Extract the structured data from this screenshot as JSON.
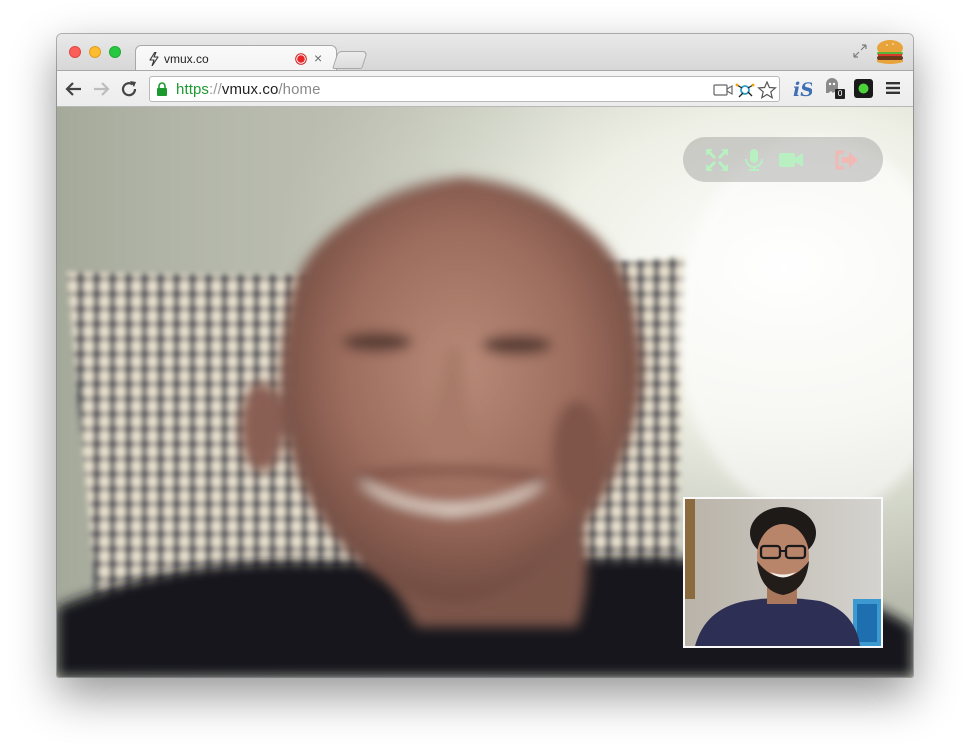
{
  "browser": {
    "tab": {
      "title": "vmux.co",
      "favicon": "bolt-icon",
      "recording_indicator": "record-dot-icon",
      "close_label": "×"
    },
    "address_bar": {
      "scheme": "https",
      "separator": "://",
      "host": "vmux.co",
      "path": "/home",
      "secure_icon": "lock-icon"
    },
    "toolbar_icons": [
      "back-arrow-icon",
      "forward-arrow-icon",
      "reload-icon",
      "camera-icon",
      "extension-network-icon",
      "star-icon",
      "is-extension-icon",
      "ghost-extension-icon",
      "green-status-extension-icon",
      "menu-icon"
    ],
    "extension_badge": "0",
    "window_buttons": [
      "close",
      "minimize",
      "zoom"
    ]
  },
  "call": {
    "controls": [
      "fullscreen-icon",
      "microphone-icon",
      "video-camera-icon",
      "leave-call-icon"
    ],
    "colors": {
      "control_active": "#b8f0c2",
      "control_leave": "#f2b8b4",
      "lock_green": "#1d9a2f"
    }
  }
}
